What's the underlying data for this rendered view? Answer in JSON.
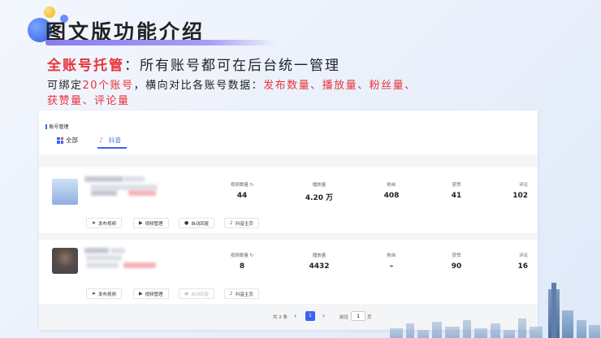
{
  "slide": {
    "title": "图文版功能介绍",
    "line1_highlight": "全账号托管",
    "line1_rest": "：所有账号都可在后台统一管理",
    "line2_a": "可绑定",
    "line2_highlight": "20个账号",
    "line2_b": "，横向对比各账号数据：",
    "line2_red": "发布数量、播放量、粉丝量、",
    "line3": "获赞量、评论量"
  },
  "app": {
    "section_label": "账号管理",
    "tabs": [
      {
        "label": "全部"
      },
      {
        "label": "抖音"
      }
    ],
    "metric_labels": {
      "videos": "视频数量",
      "views": "播放量",
      "fans": "粉丝",
      "likes": "获赞",
      "comments": "评论"
    },
    "accounts": [
      {
        "videos": "44",
        "views": "4.20 万",
        "fans": "408",
        "likes": "41",
        "comments": "102",
        "actions": [
          "发布视频",
          "视频管理",
          "自动回复",
          "抖音主页"
        ]
      },
      {
        "videos": "8",
        "views": "4432",
        "fans": "–",
        "likes": "90",
        "comments": "16",
        "actions": [
          "发布视频",
          "视频管理",
          "自动回复",
          "抖音主页"
        ]
      }
    ],
    "pagination": {
      "total": "共 2 条",
      "current_page": "1",
      "goto_label": "前往",
      "goto_value": "1",
      "goto_unit": "页"
    }
  },
  "colors": {
    "accent": "#3a63f2",
    "highlight_red": "#e8333a"
  }
}
